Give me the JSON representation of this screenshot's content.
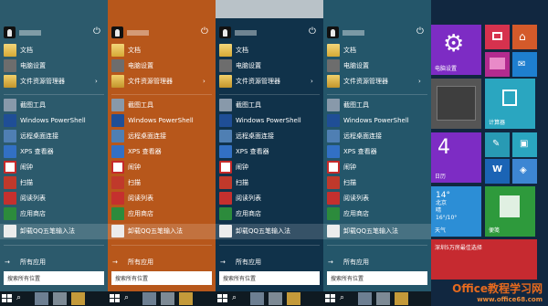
{
  "menu": {
    "items": [
      {
        "label": "文档",
        "icon": "folder-icon"
      },
      {
        "label": "电脑设置",
        "icon": "gear-icon"
      },
      {
        "label": "文件资源管理器",
        "icon": "file-explorer-icon"
      },
      {
        "label": "截图工具",
        "icon": "snipping-tool-icon"
      },
      {
        "label": "Windows PowerShell",
        "icon": "powershell-icon"
      },
      {
        "label": "远程桌面连接",
        "icon": "remote-desktop-icon"
      },
      {
        "label": "XPS 查看器",
        "icon": "xps-viewer-icon"
      },
      {
        "label": "闹钟",
        "icon": "alarm-clock-icon"
      },
      {
        "label": "扫描",
        "icon": "scan-icon"
      },
      {
        "label": "阅读列表",
        "icon": "reading-list-icon"
      },
      {
        "label": "应用商店",
        "icon": "store-icon"
      },
      {
        "label": "卸载QQ五笔输入法",
        "icon": "qq-wubi-icon"
      }
    ],
    "all_apps": "所有应用",
    "search_placeholder": "搜索所有位置",
    "chevron": "›"
  },
  "tiles": {
    "settings": "电脑设置",
    "calculator": "计算器",
    "date_number": "4",
    "date_weekday": "日历",
    "weather_temp": "14°",
    "weather_city": "北京",
    "weather_cond": "晴",
    "weather_range": "16°/10°",
    "weather_name": "天气",
    "note": "便笺",
    "banner": "深圳5万房最佳选择"
  },
  "watermark": {
    "line1": "Office教程学习网",
    "line2": "www.office68.com"
  },
  "colors": {
    "orange_panel": "#b7571b",
    "dark_panel": "#10324a",
    "teal_panel": "#2c5a6c",
    "accent_purple": "#7d2cc4"
  }
}
